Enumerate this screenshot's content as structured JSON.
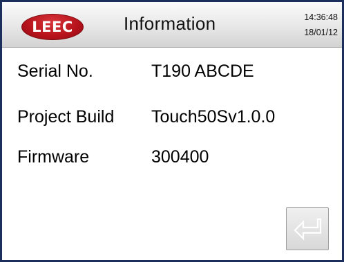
{
  "header": {
    "logo": "LEEC",
    "title": "Information",
    "time": "14:36:48",
    "date": "18/01/12"
  },
  "info": {
    "rows": [
      {
        "label": "Serial No.",
        "value": "T190 ABCDE"
      },
      {
        "label": "Project Build",
        "value": "Touch50Sv1.0.0"
      },
      {
        "label": "Firmware",
        "value": "300400"
      }
    ]
  },
  "footer": {
    "enter_button_icon": "return-arrow-icon"
  },
  "colors": {
    "frame": "#1c2f5c",
    "logo_red": "#b5121b",
    "header_gray": "#e7e7e7",
    "icon_outline": "#ffffff"
  }
}
